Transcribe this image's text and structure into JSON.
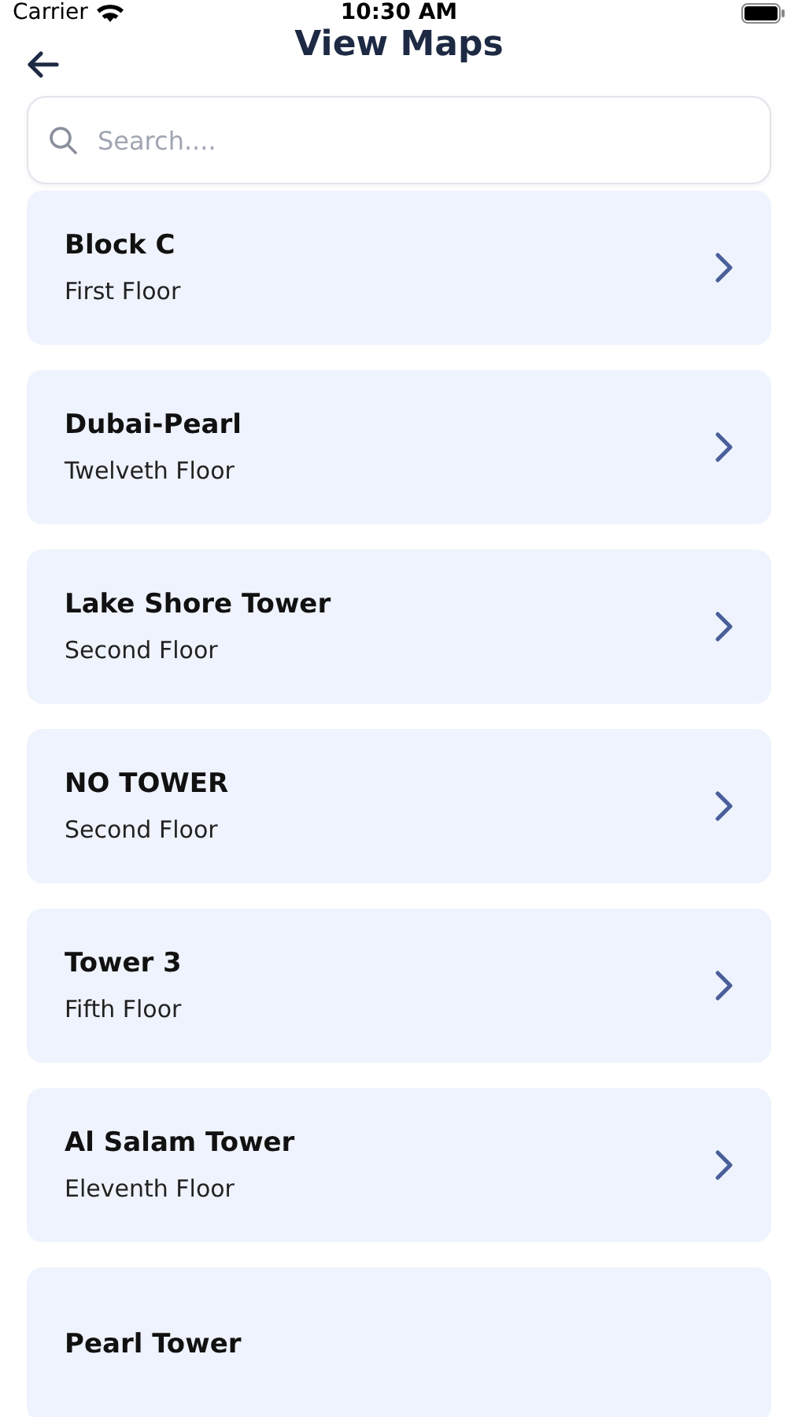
{
  "status_bar": {
    "carrier": "Carrier",
    "time": "10:30 AM"
  },
  "header": {
    "title": "View Maps"
  },
  "search": {
    "placeholder": "Search...."
  },
  "maps": [
    {
      "name": "Block C",
      "floor": "First Floor"
    },
    {
      "name": "Dubai-Pearl",
      "floor": "Twelveth Floor"
    },
    {
      "name": "Lake Shore Tower",
      "floor": "Second Floor"
    },
    {
      "name": "NO TOWER",
      "floor": "Second Floor"
    },
    {
      "name": "Tower 3",
      "floor": "Fifth Floor"
    },
    {
      "name": "Al Salam Tower",
      "floor": "Eleventh Floor"
    },
    {
      "name": "Pearl Tower"
    }
  ]
}
